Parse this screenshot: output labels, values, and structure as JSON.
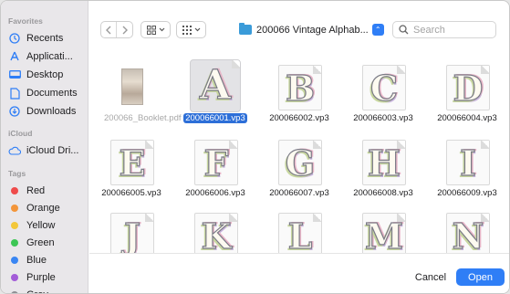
{
  "sidebar": {
    "favorites_title": "Favorites",
    "favorites": [
      {
        "label": "Recents",
        "icon": "clock-icon"
      },
      {
        "label": "Applicati...",
        "icon": "applications-icon"
      },
      {
        "label": "Desktop",
        "icon": "desktop-icon"
      },
      {
        "label": "Documents",
        "icon": "document-icon"
      },
      {
        "label": "Downloads",
        "icon": "download-icon"
      }
    ],
    "icloud_title": "iCloud",
    "icloud": [
      {
        "label": "iCloud Dri...",
        "icon": "cloud-icon"
      }
    ],
    "tags_title": "Tags",
    "tags": [
      {
        "label": "Red",
        "color": "#ef4b4b"
      },
      {
        "label": "Orange",
        "color": "#f3953a"
      },
      {
        "label": "Yellow",
        "color": "#f3c73a"
      },
      {
        "label": "Green",
        "color": "#3dc655"
      },
      {
        "label": "Blue",
        "color": "#3a86f3"
      },
      {
        "label": "Purple",
        "color": "#a35cd8"
      },
      {
        "label": "Grey",
        "color": "#8e8e93"
      }
    ]
  },
  "toolbar": {
    "back_icon": "chevron-left-icon",
    "forward_icon": "chevron-right-icon",
    "view_icon": "icon-view-icon",
    "group_icon": "group-grid-icon",
    "folder": "200066 Vintage Alphab...",
    "search_placeholder": "Search"
  },
  "files": [
    {
      "name": "200066_Booklet.pdf",
      "letter": "",
      "type": "pdf"
    },
    {
      "name": "200066001.vp3",
      "letter": "A",
      "selected": true
    },
    {
      "name": "200066002.vp3",
      "letter": "B"
    },
    {
      "name": "200066003.vp3",
      "letter": "C"
    },
    {
      "name": "200066004.vp3",
      "letter": "D"
    },
    {
      "name": "200066005.vp3",
      "letter": "E"
    },
    {
      "name": "200066006.vp3",
      "letter": "F"
    },
    {
      "name": "200066007.vp3",
      "letter": "G"
    },
    {
      "name": "200066008.vp3",
      "letter": "H"
    },
    {
      "name": "200066009.vp3",
      "letter": "I"
    },
    {
      "name": "",
      "letter": "J"
    },
    {
      "name": "",
      "letter": "K"
    },
    {
      "name": "",
      "letter": "L"
    },
    {
      "name": "",
      "letter": "M"
    },
    {
      "name": "",
      "letter": "N"
    }
  ],
  "footer": {
    "cancel_label": "Cancel",
    "open_label": "Open"
  },
  "colors": {
    "accent": "#2f7ef6",
    "selection": "#2d6fd8"
  }
}
